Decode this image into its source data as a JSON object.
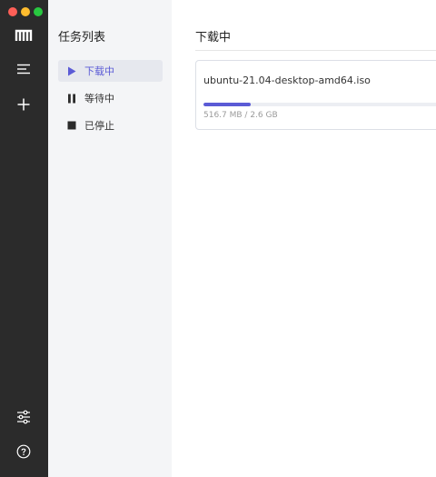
{
  "sidebar": {
    "title": "任务列表",
    "items": [
      {
        "label": "下载中",
        "icon": "play-icon",
        "active": true
      },
      {
        "label": "等待中",
        "icon": "pause-icon",
        "active": false
      },
      {
        "label": "已停止",
        "icon": "stop-icon",
        "active": false
      }
    ]
  },
  "main": {
    "title": "下载中",
    "tasks": [
      {
        "name": "ubuntu-21.04-desktop-amd64.iso",
        "size_text": "516.7 MB / 2.6 GB",
        "progress": 0.194
      }
    ]
  },
  "rail": {
    "icons": [
      "logo-icon",
      "list-icon",
      "plus-icon",
      "sliders-icon",
      "help-icon"
    ]
  },
  "colors": {
    "accent": "#5b5bd6",
    "rail_bg": "#2b2b2b",
    "sidebar_bg": "#f4f5f7"
  }
}
